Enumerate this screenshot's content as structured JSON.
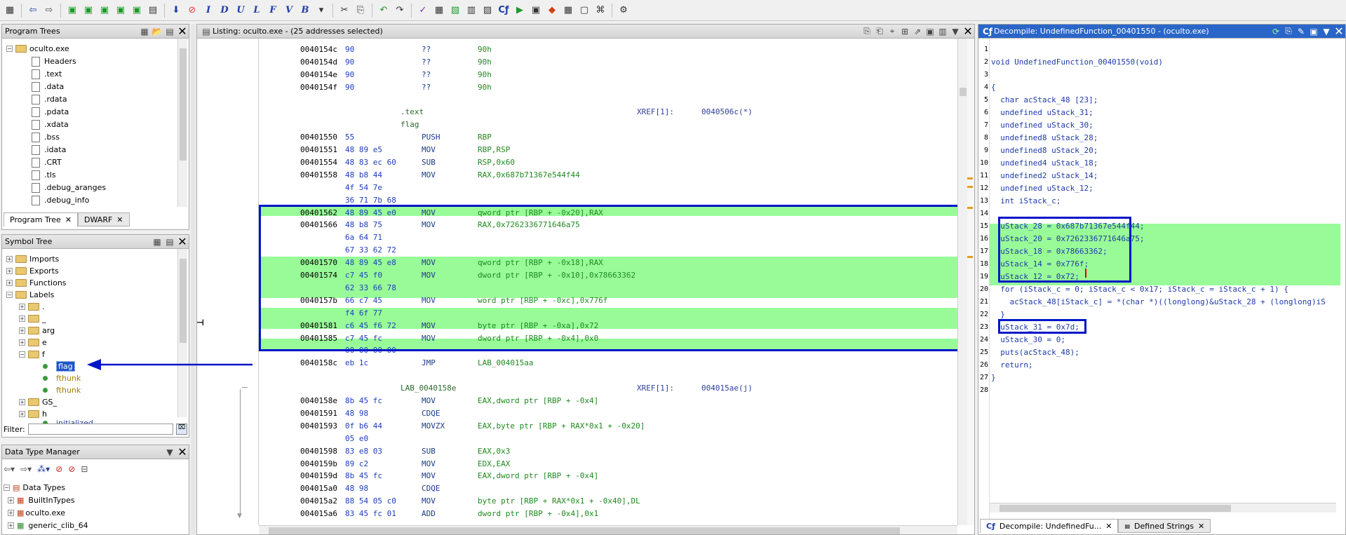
{
  "toolbar": {
    "icons": [
      "back-arrow",
      "forward-arrow",
      "home",
      "save",
      "navigate",
      "run",
      "bookmarks",
      "down-arrow",
      "stop",
      "I",
      "D",
      "U",
      "L",
      "F",
      "V",
      "B"
    ],
    "letters": [
      "I",
      "D",
      "U",
      "L",
      "F",
      "V",
      "B"
    ]
  },
  "program_trees": {
    "title": "Program Trees",
    "root": "oculto.exe",
    "items": [
      "Headers",
      ".text",
      ".data",
      ".rdata",
      ".pdata",
      ".xdata",
      ".bss",
      ".idata",
      ".CRT",
      ".tls",
      ".debug_aranges",
      ".debug_info"
    ],
    "tabs": [
      "Program Tree",
      "DWARF"
    ]
  },
  "symbol_tree": {
    "title": "Symbol Tree",
    "top": [
      "Imports",
      "Exports",
      "Functions",
      "Labels"
    ],
    "labels": [
      ".",
      "_",
      "arg",
      "e",
      "f"
    ],
    "f_children": [
      "flag",
      "fthunk",
      "fthunk"
    ],
    "after": [
      "GS_",
      "h",
      "initialized"
    ],
    "filter_label": "Filter:"
  },
  "dtm": {
    "title": "Data Type Manager",
    "root": "Data Types",
    "items": [
      "BuiltInTypes",
      "oculto.exe",
      "generic_clib_64"
    ]
  },
  "listing": {
    "title": "Listing:  oculto.exe - (25 addresses selected)",
    "rows": [
      {
        "a": "0040154c",
        "b": "90",
        "m": "??",
        "o": "90h"
      },
      {
        "a": "0040154d",
        "b": "90",
        "m": "??",
        "o": "90h"
      },
      {
        "a": "0040154e",
        "b": "90",
        "m": "??",
        "o": "90h"
      },
      {
        "a": "0040154f",
        "b": "90",
        "m": "??",
        "o": "90h"
      },
      {
        "a": "",
        "b": "",
        "m": "",
        "o": ""
      },
      {
        "a": "",
        "b": "",
        "m": "",
        "o": "",
        "lbl": ".text",
        "x": "XREF[1]:",
        "xv": "0040506c(*)"
      },
      {
        "a": "",
        "b": "",
        "m": "",
        "o": "",
        "lbl": "flag"
      },
      {
        "a": "00401550",
        "b": "55",
        "m": "PUSH",
        "o": "RBP"
      },
      {
        "a": "00401551",
        "b": "48 89 e5",
        "m": "MOV",
        "o": "RBP,RSP"
      },
      {
        "a": "00401554",
        "b": "48 83 ec 60",
        "m": "SUB",
        "o": "RSP,0x60"
      },
      {
        "a": "00401558",
        "b": "48 b8 44",
        "m": "MOV",
        "o": "RAX,0x687b71367e544f44"
      },
      {
        "a": "",
        "b": "4f 54 7e",
        "m": "",
        "o": ""
      },
      {
        "a": "",
        "b": "36 71 7b 68",
        "m": "",
        "o": ""
      },
      {
        "a": "00401562",
        "b": "48 89 45 e0",
        "m": "MOV",
        "o": "qword ptr [RBP + -0x20],RAX"
      },
      {
        "a": "00401566",
        "b": "48 b8 75",
        "m": "MOV",
        "o": "RAX,0x7262336771646a75"
      },
      {
        "a": "",
        "b": "6a 64 71",
        "m": "",
        "o": ""
      },
      {
        "a": "",
        "b": "67 33 62 72",
        "m": "",
        "o": ""
      },
      {
        "a": "00401570",
        "b": "48 89 45 e8",
        "m": "MOV",
        "o": "qword ptr [RBP + -0x18],RAX"
      },
      {
        "a": "00401574",
        "b": "c7 45 f0",
        "m": "MOV",
        "o": "dword ptr [RBP + -0x10],0x78663362"
      },
      {
        "a": "",
        "b": "62 33 66 78",
        "m": "",
        "o": ""
      },
      {
        "a": "0040157b",
        "b": "66 c7 45",
        "m": "MOV",
        "o": "word ptr [RBP + -0xc],0x776f"
      },
      {
        "a": "",
        "b": "f4 6f 77",
        "m": "",
        "o": ""
      },
      {
        "a": "00401581",
        "b": "c6 45 f6 72",
        "m": "MOV",
        "o": "byte ptr [RBP + -0xa],0x72"
      },
      {
        "a": "00401585",
        "b": "c7 45 fc",
        "m": "MOV",
        "o": "dword ptr [RBP + -0x4],0x0"
      },
      {
        "a": "",
        "b": "00 00 00 00",
        "m": "",
        "o": ""
      },
      {
        "a": "0040158c",
        "b": "eb 1c",
        "m": "JMP",
        "o": "LAB_004015aa"
      },
      {
        "a": "",
        "b": "",
        "m": "",
        "o": ""
      },
      {
        "a": "",
        "b": "",
        "m": "",
        "o": "",
        "lbl": "LAB_0040158e",
        "x": "XREF[1]:",
        "xv": "004015ae(j)"
      },
      {
        "a": "0040158e",
        "b": "8b 45 fc",
        "m": "MOV",
        "o": "EAX,dword ptr [RBP + -0x4]"
      },
      {
        "a": "00401591",
        "b": "48 98",
        "m": "CDQE",
        "o": ""
      },
      {
        "a": "00401593",
        "b": "0f b6 44",
        "m": "MOVZX",
        "o": "EAX,byte ptr [RBP + RAX*0x1 + -0x20]"
      },
      {
        "a": "",
        "b": "05 e0",
        "m": "",
        "o": ""
      },
      {
        "a": "00401598",
        "b": "83 e8 03",
        "m": "SUB",
        "o": "EAX,0x3"
      },
      {
        "a": "0040159b",
        "b": "89 c2",
        "m": "MOV",
        "o": "EDX,EAX"
      },
      {
        "a": "0040159d",
        "b": "8b 45 fc",
        "m": "MOV",
        "o": "EAX,dword ptr [RBP + -0x4]"
      },
      {
        "a": "004015a0",
        "b": "48 98",
        "m": "CDQE",
        "o": ""
      },
      {
        "a": "004015a2",
        "b": "88 54 05 c0",
        "m": "MOV",
        "o": "byte ptr [RBP + RAX*0x1 + -0x40],DL"
      },
      {
        "a": "004015a6",
        "b": "83 45 fc 01",
        "m": "ADD",
        "o": "dword ptr [RBP + -0x4],0x1"
      }
    ]
  },
  "decompile": {
    "title": "Decompile: UndefinedFunction_00401550 - (oculto.exe)",
    "lines": [
      "",
      "void UndefinedFunction_00401550(void)",
      "",
      "{",
      "  char acStack_48 [23];",
      "  undefined uStack_31;",
      "  undefined uStack_30;",
      "  undefined8 uStack_28;",
      "  undefined8 uStack_20;",
      "  undefined4 uStack_18;",
      "  undefined2 uStack_14;",
      "  undefined uStack_12;",
      "  int iStack_c;",
      "",
      "  uStack_28 = 0x687b71367e544f44;",
      "  uStack_20 = 0x7262336771646a75;",
      "  uStack_18 = 0x78663362;",
      "  uStack_14 = 0x776f;",
      "  uStack_12 = 0x72;",
      "  for (iStack_c = 0; iStack_c < 0x17; iStack_c = iStack_c + 1) {",
      "    acStack_48[iStack_c] = *(char *)((longlong)&uStack_28 + (longlong)iS",
      "  }",
      "  uStack_31 = 0x7d;",
      "  uStack_30 = 0;",
      "  puts(acStack_48);",
      "  return;",
      "}",
      ""
    ],
    "tabs": [
      "Decompile: UndefinedFu...",
      "Defined Strings"
    ]
  }
}
